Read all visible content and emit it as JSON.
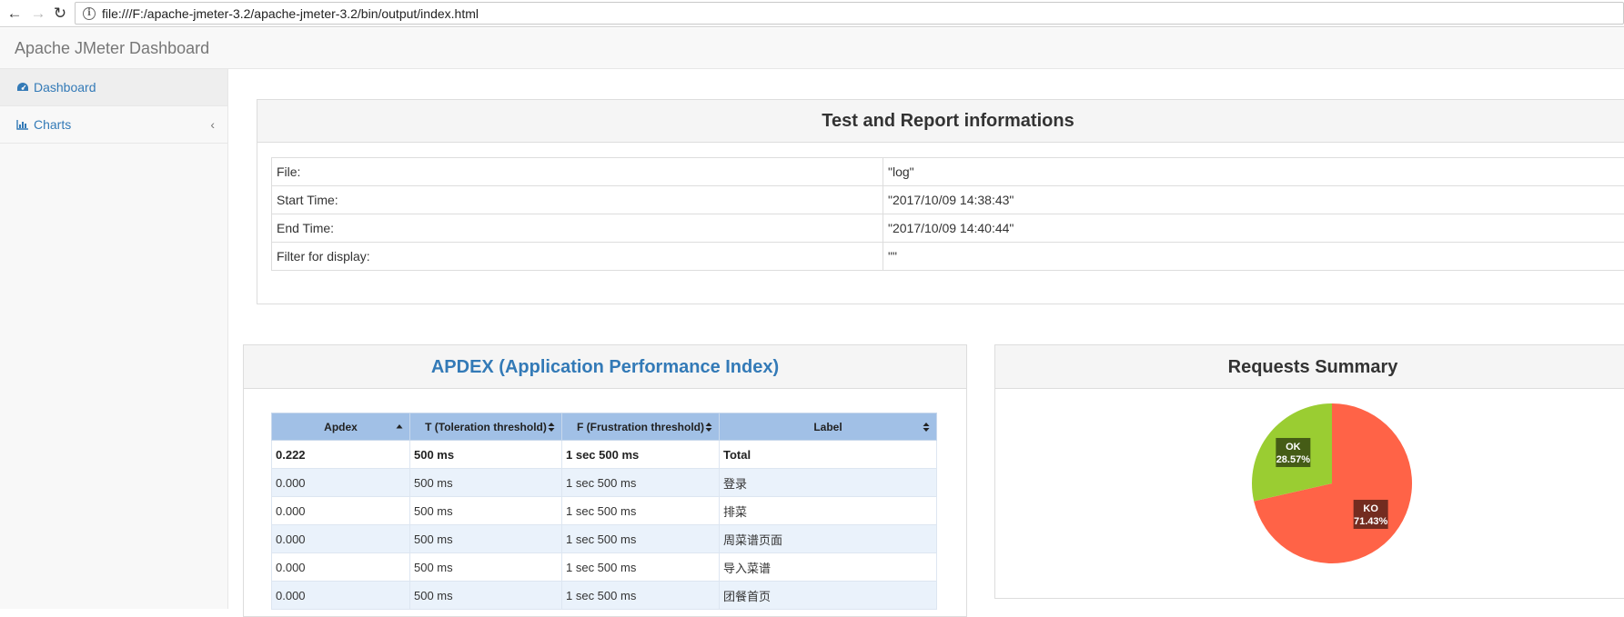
{
  "browser": {
    "url": "file:///F:/apache-jmeter-3.2/apache-jmeter-3.2/bin/output/index.html"
  },
  "app": {
    "brand": "Apache JMeter Dashboard"
  },
  "sidebar": {
    "items": [
      {
        "label": "Dashboard",
        "icon": "dashboard-icon",
        "active": true
      },
      {
        "label": "Charts",
        "icon": "bar-chart-icon",
        "active": false
      }
    ]
  },
  "info_panel": {
    "title": "Test and Report informations",
    "rows": [
      {
        "key": "File:",
        "value": "\"log\""
      },
      {
        "key": "Start Time:",
        "value": "\"2017/10/09 14:38:43\""
      },
      {
        "key": "End Time:",
        "value": "\"2017/10/09 14:40:44\""
      },
      {
        "key": "Filter for display:",
        "value": "\"\""
      }
    ]
  },
  "apdex": {
    "title": "APDEX (Application Performance Index)",
    "columns": [
      "Apdex",
      "T (Toleration threshold)",
      "F (Frustration threshold)",
      "Label"
    ],
    "rows": [
      [
        "0.222",
        "500 ms",
        "1 sec 500 ms",
        "Total"
      ],
      [
        "0.000",
        "500 ms",
        "1 sec 500 ms",
        "登录"
      ],
      [
        "0.000",
        "500 ms",
        "1 sec 500 ms",
        "排菜"
      ],
      [
        "0.000",
        "500 ms",
        "1 sec 500 ms",
        "周菜谱页面"
      ],
      [
        "0.000",
        "500 ms",
        "1 sec 500 ms",
        "导入菜谱"
      ],
      [
        "0.000",
        "500 ms",
        "1 sec 500 ms",
        "团餐首页"
      ]
    ]
  },
  "requests_summary": {
    "title": "Requests Summary"
  },
  "chart_data": {
    "type": "pie",
    "title": "Requests Summary",
    "slices": [
      {
        "name": "KO",
        "value": 71.43,
        "label": "71.43%",
        "color": "#ff6347"
      },
      {
        "name": "OK",
        "value": 28.57,
        "label": "28.57%",
        "color": "#9acd32"
      }
    ]
  }
}
